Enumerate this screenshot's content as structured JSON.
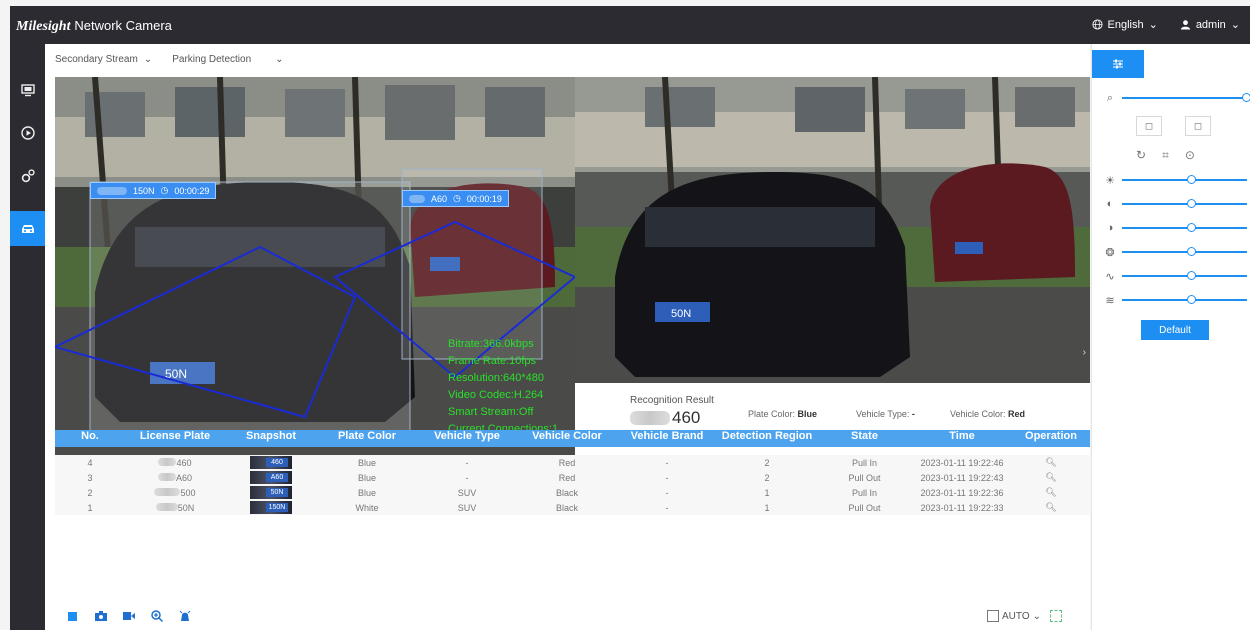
{
  "header": {
    "brand": "Milesight",
    "title": "Network Camera",
    "language": "English",
    "user": "admin"
  },
  "nav": [
    "live-view",
    "playback",
    "settings",
    "vehicle"
  ],
  "subtabs": {
    "stream": "Secondary Stream",
    "mode": "Parking Detection"
  },
  "video": {
    "tag1": "150N",
    "tag1_time": "00:00:29",
    "tag2": "A60",
    "tag2_time": "00:00:19",
    "plate_left": "50N",
    "plate_right": "50N",
    "overlay": [
      "Bitrate:366.0kbps",
      "Frame Rate:10fps",
      "Resolution:640*480",
      "Video Codec:H.264",
      "Smart Stream:Off",
      "Current Connections:1"
    ]
  },
  "recognition": {
    "title": "Recognition Result",
    "plate_suffix": "460",
    "plate_color_label": "Plate Color:",
    "plate_color": "Blue",
    "vehicle_type_label": "Vehicle Type:",
    "vehicle_type": "-",
    "vehicle_color_label": "Vehicle Color:",
    "vehicle_color": "Red"
  },
  "table": {
    "headers": [
      "No.",
      "License Plate",
      "Snapshot",
      "Plate Color",
      "Vehicle Type",
      "Vehicle Color",
      "Vehicle Brand",
      "Detection Region",
      "State",
      "Time",
      "Operation"
    ],
    "rows": [
      {
        "no": "4",
        "plate": "460",
        "snap": "460",
        "plate_color": "Blue",
        "vehicle_type": "-",
        "vehicle_color": "Red",
        "brand": "-",
        "region": "2",
        "state": "Pull In",
        "time": "2023-01-11 19:22:46"
      },
      {
        "no": "3",
        "plate": "A60",
        "snap": "A60",
        "plate_color": "Blue",
        "vehicle_type": "-",
        "vehicle_color": "Red",
        "brand": "-",
        "region": "2",
        "state": "Pull Out",
        "time": "2023-01-11 19:22:43"
      },
      {
        "no": "2",
        "plate": "500",
        "snap": "50N",
        "plate_color": "Blue",
        "vehicle_type": "SUV",
        "vehicle_color": "Black",
        "brand": "-",
        "region": "1",
        "state": "Pull In",
        "time": "2023-01-11 19:22:36"
      },
      {
        "no": "1",
        "plate": "50N",
        "snap": "150N",
        "plate_color": "White",
        "vehicle_type": "SUV",
        "vehicle_color": "Black",
        "brand": "-",
        "region": "1",
        "state": "Pull Out",
        "time": "2023-01-11 19:22:33"
      }
    ]
  },
  "bottombar": {
    "zoom_mode": "AUTO"
  },
  "rightpanel": {
    "default_label": "Default"
  },
  "colors": {
    "accent": "#1e8ff2",
    "header_bg": "#2b2b31",
    "table_header": "#4da3ee",
    "overlay_text": "#2adf2a"
  }
}
